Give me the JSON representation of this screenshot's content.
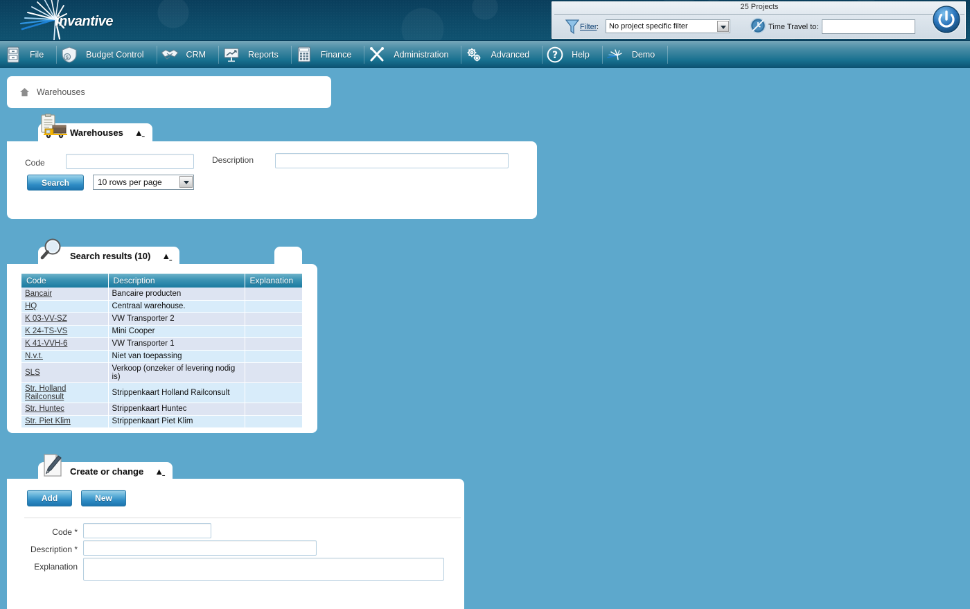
{
  "app": {
    "brand": "invantive",
    "background_color": "#5da8cc",
    "header_color": "#0d4a68",
    "accent_color": "#1c74ae"
  },
  "topbar": {
    "projects_count_label": "25 Projects",
    "filter_icon": "funnel-icon",
    "filter_link_label": "Filter",
    "filter_colon": ":",
    "filter_select_value": "No project specific filter",
    "filter_select_options": [
      "No project specific filter"
    ],
    "clock_icon": "clock-icon",
    "time_travel_label": "Time Travel to:",
    "time_travel_value": "",
    "time_travel_placeholder": "",
    "power_icon": "power-icon"
  },
  "menu": {
    "items": [
      {
        "label": "File",
        "icon": "file-cabinet-icon"
      },
      {
        "label": "Budget Control",
        "icon": "shield-dollar-icon"
      },
      {
        "label": "CRM",
        "icon": "handshake-icon"
      },
      {
        "label": "Reports",
        "icon": "presentation-chart-icon"
      },
      {
        "label": "Finance",
        "icon": "calculator-icon"
      },
      {
        "label": "Administration",
        "icon": "wrench-screwdriver-icon"
      },
      {
        "label": "Advanced",
        "icon": "gears-icon"
      },
      {
        "label": "Help",
        "icon": "question-circle-icon"
      },
      {
        "label": "Demo",
        "icon": "invantive-mark-icon"
      }
    ]
  },
  "breadcrumb": {
    "home_icon": "home-icon",
    "label": "Warehouses"
  },
  "search_panel": {
    "title": "Warehouses",
    "icon": "clipboard-truck-icon",
    "collapse_icon": "chevron-double-up-icon",
    "code_label": "Code",
    "code_value": "",
    "description_label": "Description",
    "description_value": "",
    "search_button": "Search",
    "rows_per_page_value": "10 rows per page",
    "rows_per_page_options": [
      "10 rows per page"
    ]
  },
  "results_panel": {
    "title": "Search results (10)",
    "icon": "magnifier-icon",
    "collapse_icon": "chevron-double-up-icon",
    "columns": [
      "Code",
      "Description",
      "Explanation"
    ],
    "rows": [
      {
        "code": "Bancair",
        "description": "Bancaire producten",
        "explanation": ""
      },
      {
        "code": "HQ",
        "description": "Centraal warehouse.",
        "explanation": ""
      },
      {
        "code": "K 03-VV-SZ",
        "description": "VW Transporter 2",
        "explanation": ""
      },
      {
        "code": "K 24-TS-VS",
        "description": "Mini Cooper",
        "explanation": ""
      },
      {
        "code": "K 41-VVH-6",
        "description": "VW Transporter 1",
        "explanation": ""
      },
      {
        "code": "N.v.t.",
        "description": "Niet van toepassing",
        "explanation": ""
      },
      {
        "code": "SLS",
        "description": "Verkoop (onzeker of levering nodig is)",
        "explanation": ""
      },
      {
        "code": "Str. Holland Railconsult",
        "description": "Strippenkaart Holland Railconsult",
        "explanation": ""
      },
      {
        "code": "Str. Huntec",
        "description": "Strippenkaart Huntec",
        "explanation": ""
      },
      {
        "code": "Str. Piet Klim",
        "description": "Strippenkaart Piet Klim",
        "explanation": ""
      }
    ]
  },
  "create_panel": {
    "title": "Create or change",
    "icon": "page-pen-icon",
    "collapse_icon": "chevron-double-up-icon",
    "add_button": "Add",
    "new_button": "New",
    "code_label": "Code *",
    "code_value": "",
    "description_label": "Description *",
    "description_value": "",
    "explanation_label": "Explanation",
    "explanation_value": ""
  }
}
